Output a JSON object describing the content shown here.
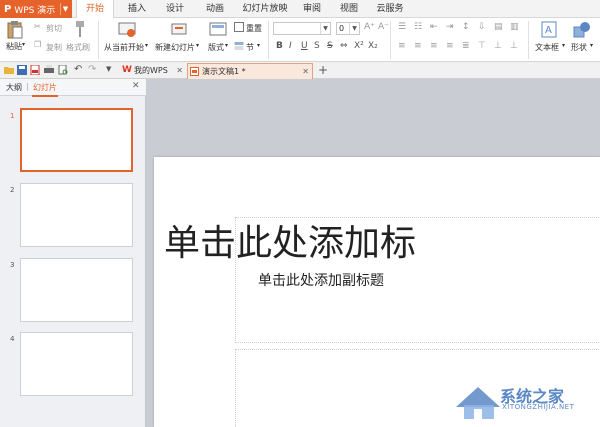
{
  "app": {
    "name": "WPS 演示"
  },
  "menu_tabs": [
    "开始",
    "插入",
    "设计",
    "动画",
    "幻灯片放映",
    "审阅",
    "视图",
    "云服务"
  ],
  "ribbon": {
    "paste": "粘贴",
    "cut": "剪切",
    "copy": "复制",
    "format_painter": "格式刷",
    "from_current": "从当前开始",
    "new_slide": "新建幻灯片",
    "layout": "版式",
    "reset": "重置",
    "section": "节",
    "font_size": "0",
    "textbox": "文本框",
    "shape": "形状"
  },
  "doc_tabs": [
    {
      "label": "我的WPS"
    },
    {
      "label": "演示文稿1 *"
    }
  ],
  "pane": {
    "tab_outline": "大纲",
    "tab_slides": "幻灯片",
    "slide_numbers": [
      "1",
      "2",
      "3",
      "4"
    ]
  },
  "slide": {
    "title_placeholder": "单击此处添加标",
    "subtitle_placeholder": "单击此处添加副标题"
  },
  "watermark": {
    "text": "系统之家",
    "url": "XITONGZHIJIA.NET"
  },
  "colors": {
    "accent": "#e5632b",
    "watermark": "#5a87c5"
  }
}
